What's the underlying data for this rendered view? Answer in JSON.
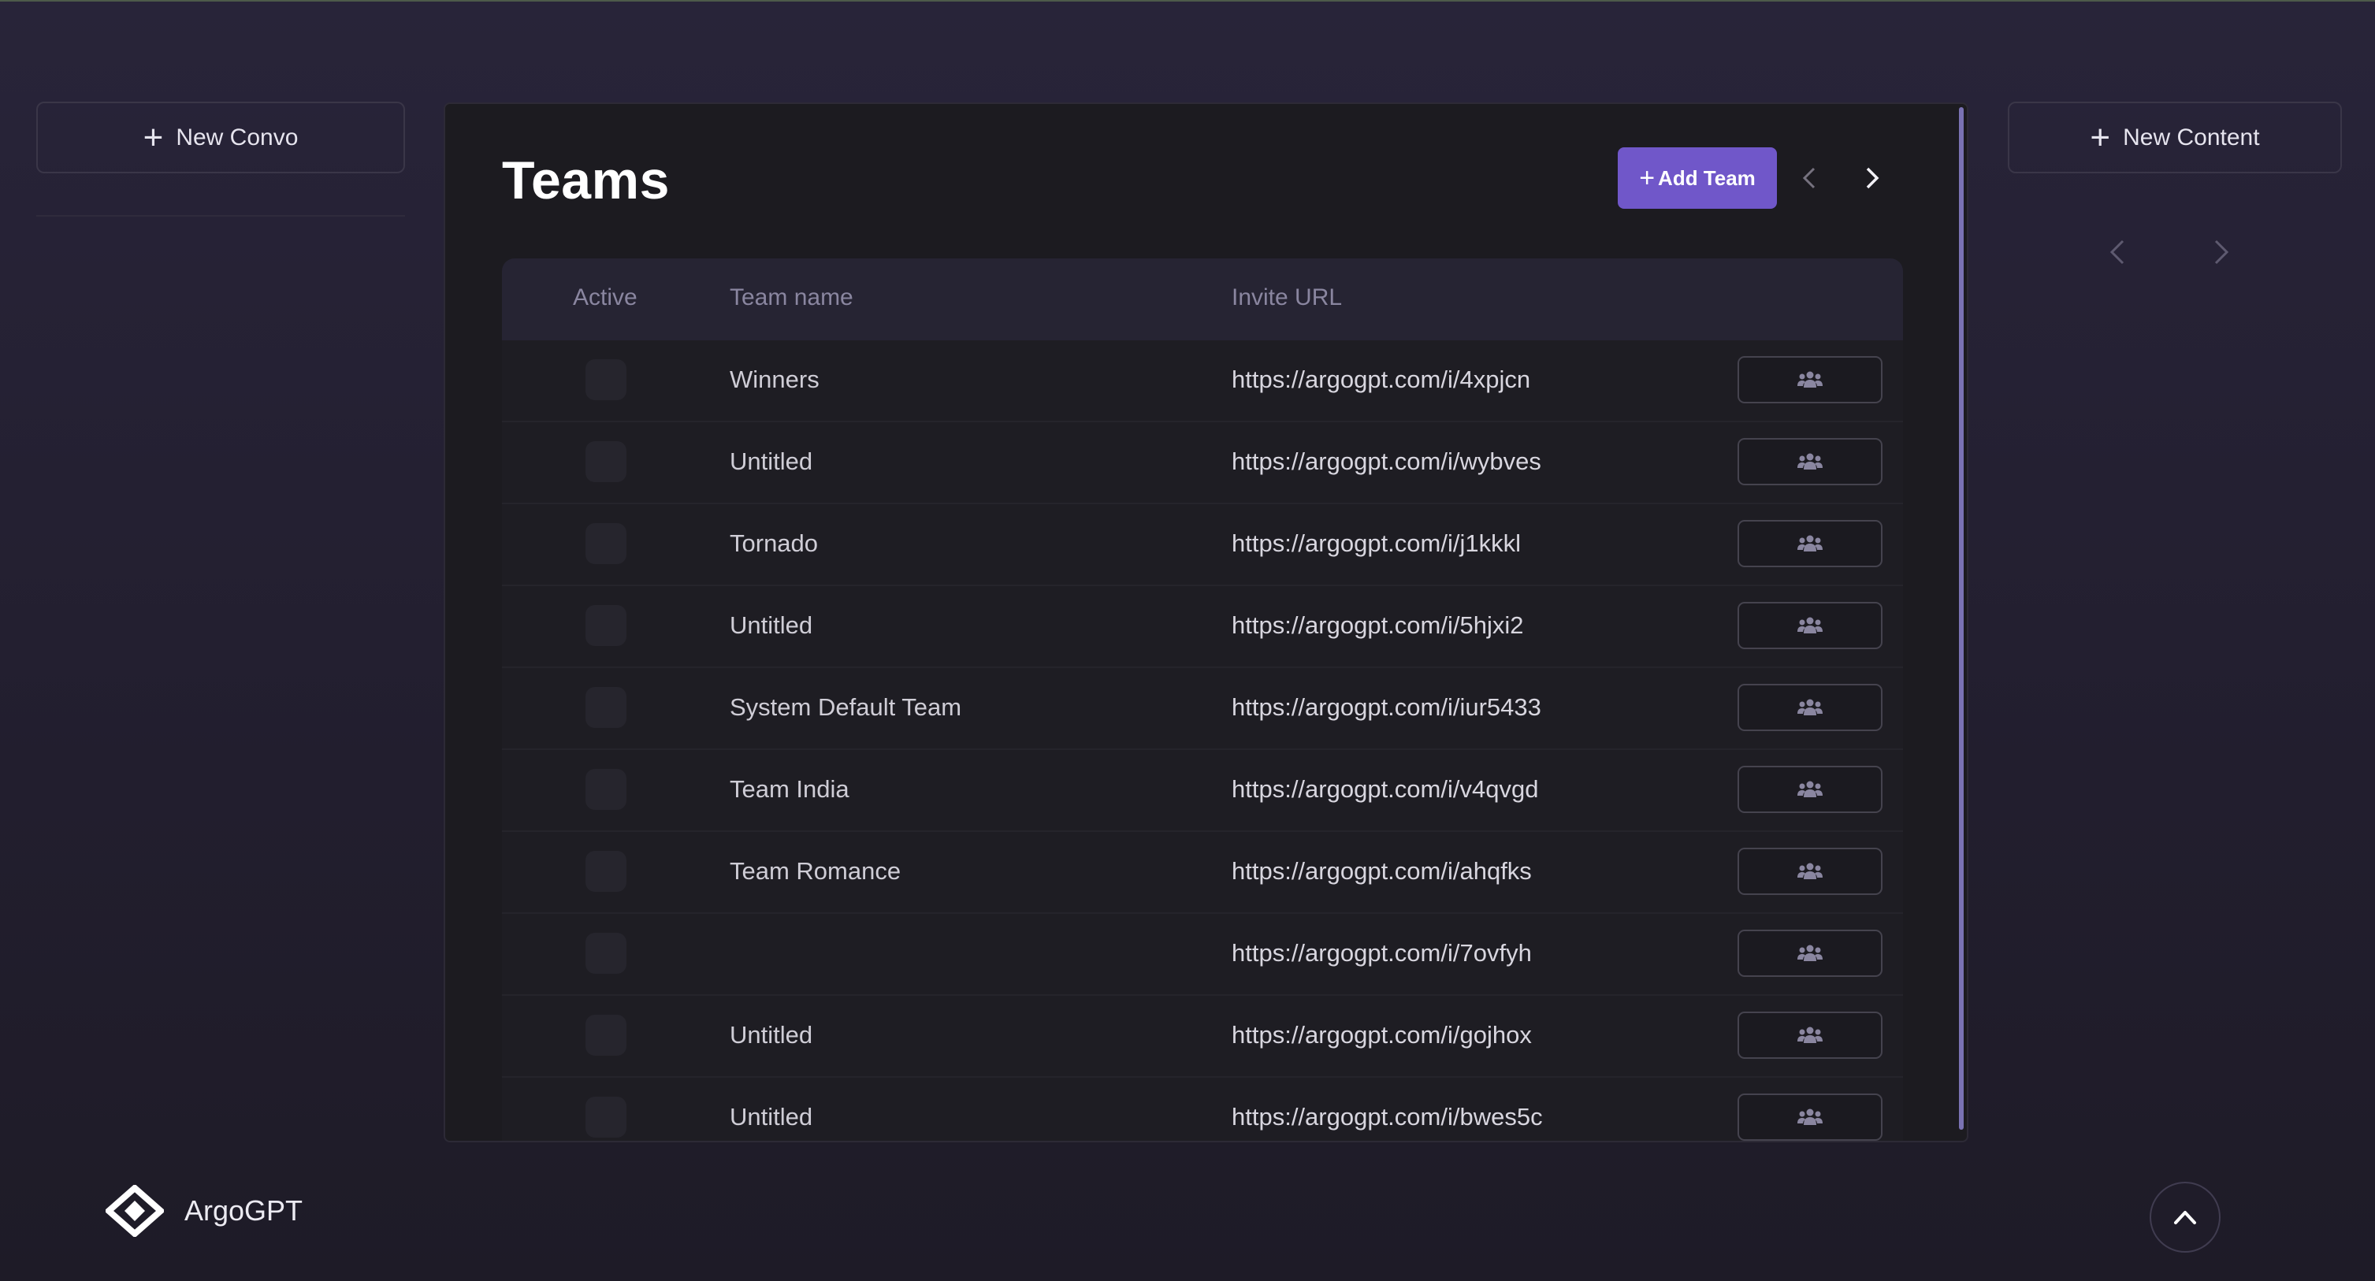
{
  "left_sidebar": {
    "new_button_label": "New Convo",
    "logo_text": "ArgoGPT"
  },
  "right_sidebar": {
    "new_button_label": "New Content"
  },
  "main": {
    "title": "Teams",
    "add_button_label": "Add Team",
    "table": {
      "columns": [
        "Active",
        "Team name",
        "Invite URL"
      ],
      "rows": [
        {
          "name": "Winners",
          "url": "https://argogpt.com/i/4xpjcn"
        },
        {
          "name": "Untitled",
          "url": "https://argogpt.com/i/wybves"
        },
        {
          "name": "Tornado",
          "url": "https://argogpt.com/i/j1kkkl"
        },
        {
          "name": "Untitled",
          "url": "https://argogpt.com/i/5hjxi2"
        },
        {
          "name": "System Default Team",
          "url": "https://argogpt.com/i/iur5433"
        },
        {
          "name": "Team India",
          "url": "https://argogpt.com/i/v4qvgd"
        },
        {
          "name": "Team Romance",
          "url": "https://argogpt.com/i/ahqfks"
        },
        {
          "name": "",
          "url": "https://argogpt.com/i/7ovfyh"
        },
        {
          "name": "Untitled",
          "url": "https://argogpt.com/i/gojhox"
        },
        {
          "name": "Untitled",
          "url": "https://argogpt.com/i/bwes5c"
        }
      ]
    }
  },
  "colors": {
    "accent": "#7057c9",
    "panel_bg": "#1c1b20",
    "header_bg": "#262433",
    "page_bg": "#282439"
  },
  "icons": [
    "plus-icon",
    "chevron-left-icon",
    "chevron-right-icon",
    "team-members-icon",
    "chevron-up-icon",
    "argogpt-logo-icon"
  ]
}
